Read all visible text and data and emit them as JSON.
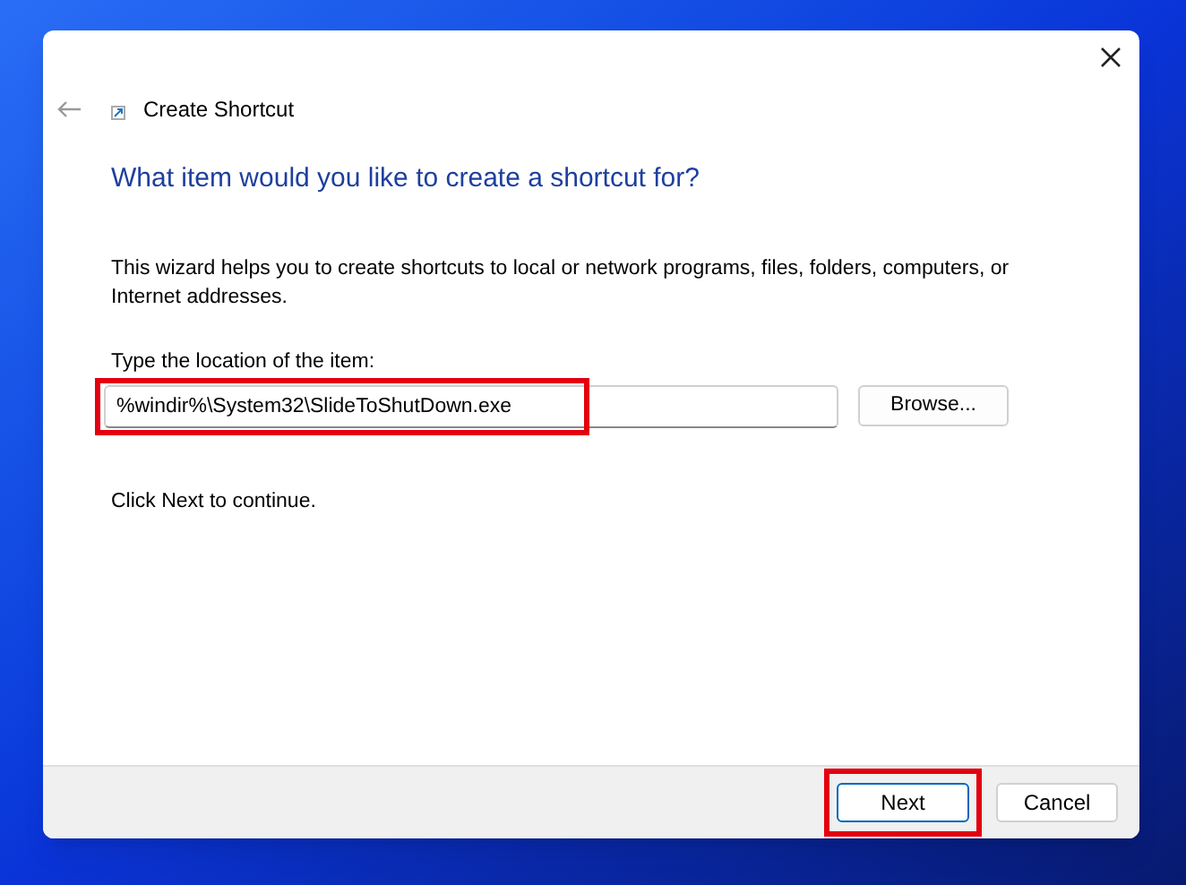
{
  "window": {
    "title": "Create Shortcut"
  },
  "heading": "What item would you like to create a shortcut for?",
  "description": "This wizard helps you to create shortcuts to local or network programs, files, folders, computers, or Internet addresses.",
  "location_field": {
    "label": "Type the location of the item:",
    "value": "%windir%\\System32\\SlideToShutDown.exe",
    "highlighted": true
  },
  "browse_button": "Browse...",
  "hint": "Click Next to continue.",
  "buttons": [
    {
      "label": "Next",
      "highlighted": true,
      "default": true
    },
    {
      "label": "Cancel",
      "highlighted": false,
      "default": false
    }
  ]
}
